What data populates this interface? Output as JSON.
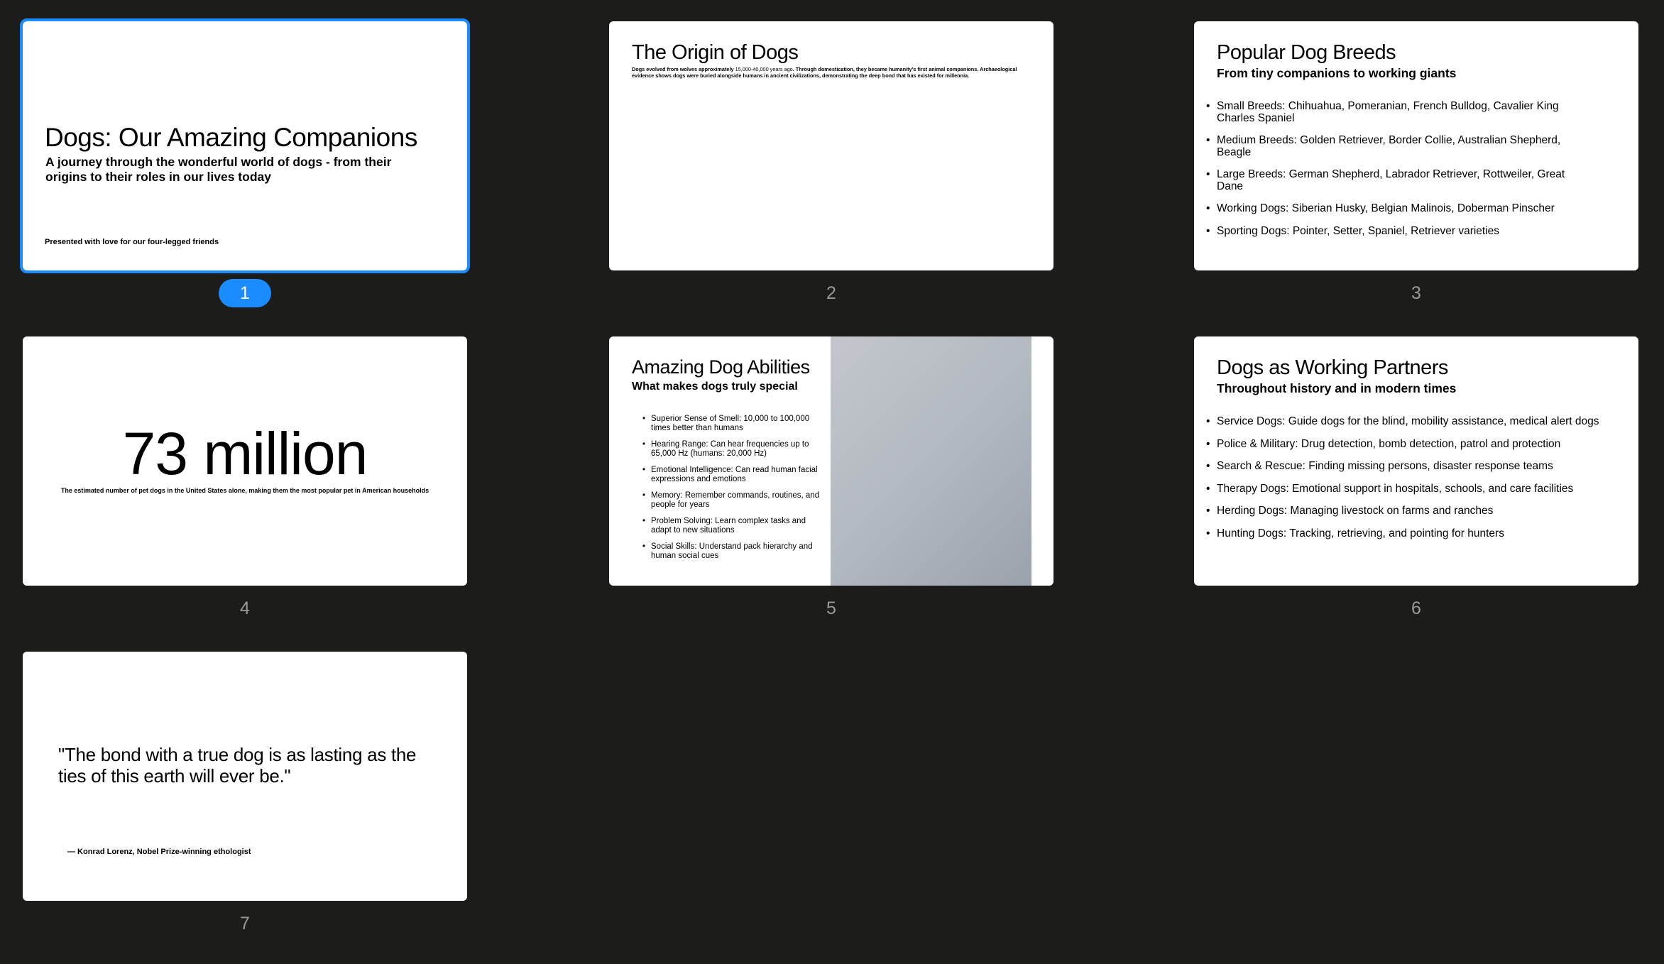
{
  "selected_slide": 1,
  "slides": [
    {
      "number": "1",
      "title": "Dogs: Our Amazing Companions",
      "subtitle": "A journey through the wonderful world of dogs - from their origins to their roles in our lives today",
      "footer": "Presented with love for our four-legged friends"
    },
    {
      "number": "2",
      "title": "The Origin of Dogs",
      "body_part1": "Dogs evolved from wolves approximately ",
      "body_highlight": "15,000-40,000 years ago",
      "body_part2": ". Through domestication, they became humanity's first animal companions. Archaeological evidence shows dogs were buried alongside humans in ancient civilizations, demonstrating the deep bond that has existed for millennia."
    },
    {
      "number": "3",
      "title": "Popular Dog Breeds",
      "subtitle": "From tiny companions to working giants",
      "bullets": [
        "Small Breeds: Chihuahua, Pomeranian, French Bulldog, Cavalier King Charles Spaniel",
        "Medium Breeds: Golden Retriever, Border Collie, Australian Shepherd, Beagle",
        "Large Breeds: German Shepherd, Labrador Retriever, Rottweiler, Great Dane",
        "Working Dogs: Siberian Husky, Belgian Malinois, Doberman Pinscher",
        "Sporting Dogs: Pointer, Setter, Spaniel, Retriever varieties"
      ]
    },
    {
      "number": "4",
      "stat": "73 million",
      "caption": "The estimated number of pet dogs in the United States alone, making them the most popular pet in American households"
    },
    {
      "number": "5",
      "title": "Amazing Dog Abilities",
      "subtitle": "What makes dogs truly special",
      "bullets": [
        "Superior Sense of Smell: 10,000 to 100,000 times better than humans",
        "Hearing Range: Can hear frequencies up to 65,000 Hz (humans: 20,000 Hz)",
        "Emotional Intelligence: Can read human facial expressions and emotions",
        "Memory: Remember commands, routines, and people for years",
        "Problem Solving: Learn complex tasks and adapt to new situations",
        "Social Skills: Understand pack hierarchy and human social cues"
      ]
    },
    {
      "number": "6",
      "title": "Dogs as Working Partners",
      "subtitle": "Throughout history and in modern times",
      "bullets": [
        "Service Dogs: Guide dogs for the blind, mobility assistance, medical alert dogs",
        "Police & Military: Drug detection, bomb detection, patrol and protection",
        "Search & Rescue: Finding missing persons, disaster response teams",
        "Therapy Dogs: Emotional support in hospitals, schools, and care facilities",
        "Herding Dogs: Managing livestock on farms and ranches",
        "Hunting Dogs: Tracking, retrieving, and pointing for hunters"
      ]
    },
    {
      "number": "7",
      "quote": "\"The bond with a true dog is as lasting as the ties of this earth will ever be.\"",
      "attribution": "— Konrad Lorenz, Nobel Prize-winning ethologist"
    }
  ],
  "colors": {
    "background": "#1c1c1a",
    "selection": "#1a8cff",
    "slide_number": "#9a9a96"
  }
}
